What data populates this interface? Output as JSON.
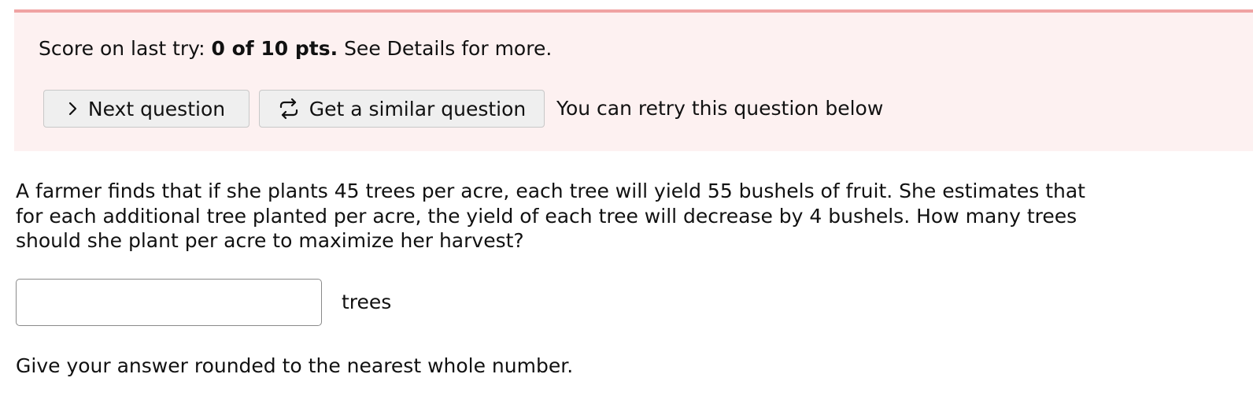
{
  "score": {
    "prefix": "Score on last try:",
    "value": "0 of 10 pts.",
    "suffix": "See Details for more."
  },
  "buttons": {
    "next_label": "Next question",
    "similar_label": "Get a similar question"
  },
  "icons": {
    "next": "chevron-right-icon",
    "similar": "repeat-icon"
  },
  "retry_note": "You can retry this question below",
  "question": {
    "text": "A farmer finds that if she plants 45 trees per acre, each tree will yield 55 bushels of fruit. She estimates that for each additional tree planted per acre, the yield of each tree will decrease by 4 bushels. How many trees should she plant per acre to maximize her harvest?"
  },
  "answer": {
    "value": "",
    "unit": "trees"
  },
  "hint": "Give your answer rounded to the nearest whole number.",
  "colors": {
    "panel_background": "#fdf1f1",
    "panel_border": "#f0a3a3",
    "button_background": "#efefef"
  }
}
